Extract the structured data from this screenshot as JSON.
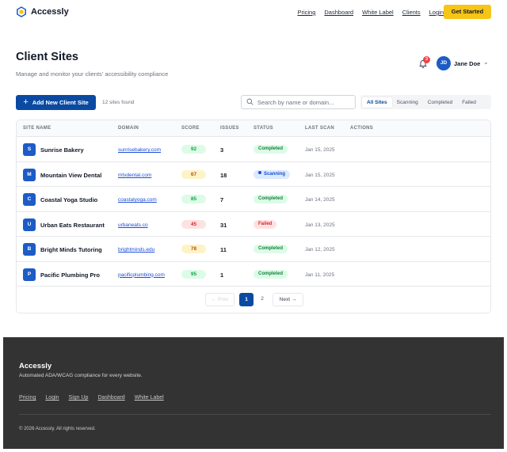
{
  "brand": {
    "name": "Accessly",
    "accent": "#0b4aa2",
    "cta_color": "#f5c518"
  },
  "nav": {
    "links": [
      "Pricing",
      "Dashboard",
      "White Label",
      "Clients",
      "Login"
    ],
    "cta": "Get Started"
  },
  "page": {
    "title": "Client Sites",
    "subtitle": "Manage and monitor your clients' accessibility compliance"
  },
  "user": {
    "initials": "JD",
    "name": "Jane Doe",
    "notifications": "3"
  },
  "toolbar": {
    "add_label": "Add New Client Site",
    "count": "12 sites found",
    "search_placeholder": "Search by name or domain...",
    "filters": [
      "All Sites",
      "Scanning",
      "Completed",
      "Failed"
    ],
    "active_filter": "All Sites"
  },
  "table": {
    "headers": [
      "SITE NAME",
      "DOMAIN",
      "SCORE",
      "ISSUES",
      "STATUS",
      "LAST SCAN",
      "ACTIONS"
    ],
    "rows": [
      {
        "initial": "S",
        "name": "Sunrise Bakery",
        "domain": "sunrisebakery.com",
        "score": "92",
        "issues": "3",
        "status": "Completed",
        "last_scan": "Jan 15, 2025"
      },
      {
        "initial": "M",
        "name": "Mountain View Dental",
        "domain": "mtvdental.com",
        "score": "67",
        "issues": "18",
        "status": "Scanning",
        "last_scan": "Jan 15, 2025"
      },
      {
        "initial": "C",
        "name": "Coastal Yoga Studio",
        "domain": "coastalyoga.com",
        "score": "85",
        "issues": "7",
        "status": "Completed",
        "last_scan": "Jan 14, 2025"
      },
      {
        "initial": "U",
        "name": "Urban Eats Restaurant",
        "domain": "urbaneats.co",
        "score": "45",
        "issues": "31",
        "status": "Failed",
        "last_scan": "Jan 13, 2025"
      },
      {
        "initial": "B",
        "name": "Bright Minds Tutoring",
        "domain": "brightminds.edu",
        "score": "78",
        "issues": "11",
        "status": "Completed",
        "last_scan": "Jan 12, 2025"
      },
      {
        "initial": "P",
        "name": "Pacific Plumbing Pro",
        "domain": "pacificplumbing.com",
        "score": "95",
        "issues": "1",
        "status": "Completed",
        "last_scan": "Jan 11, 2025"
      }
    ]
  },
  "pagination": {
    "prev": "← Prev",
    "pages": [
      "1",
      "2"
    ],
    "current": "1",
    "next": "Next →"
  },
  "footer": {
    "title": "Accessly",
    "description": "Automated ADA/WCAG compliance for every website.",
    "links": [
      "Pricing",
      "Login",
      "Sign Up",
      "Dashboard",
      "White Label"
    ],
    "copyright": "© 2026 Accessly. All rights reserved."
  }
}
